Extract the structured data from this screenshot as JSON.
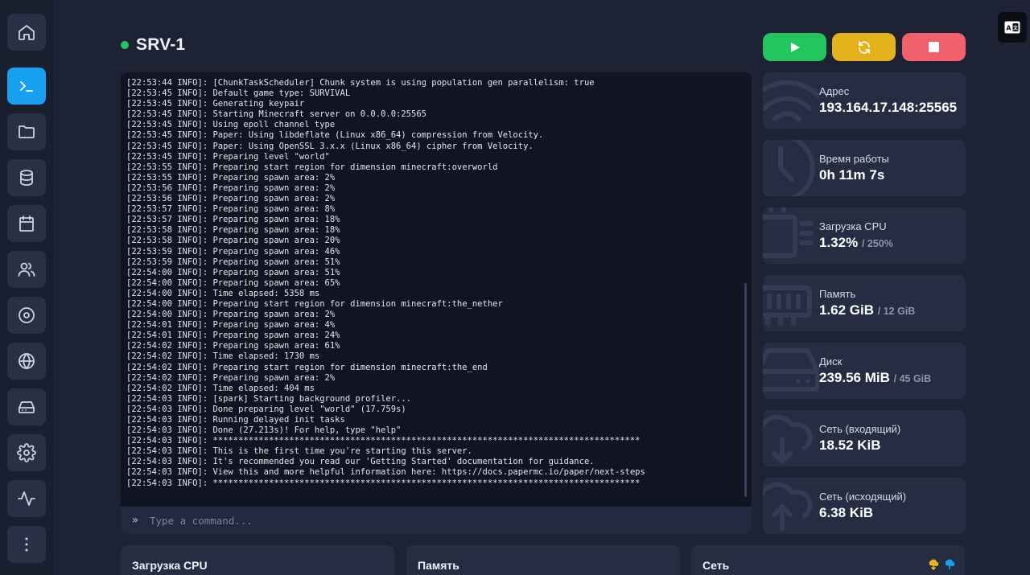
{
  "sidebar": {
    "items": [
      {
        "name": "home-icon",
        "active": false
      },
      {
        "name": "console-icon",
        "active": true
      },
      {
        "name": "folder-icon",
        "active": false
      },
      {
        "name": "database-icon",
        "active": false
      },
      {
        "name": "calendar-icon",
        "active": false
      },
      {
        "name": "users-icon",
        "active": false
      },
      {
        "name": "disc-icon",
        "active": false
      },
      {
        "name": "globe-icon",
        "active": false
      },
      {
        "name": "drive-icon",
        "active": false
      },
      {
        "name": "gear-icon",
        "active": false
      },
      {
        "name": "activity-icon",
        "active": false
      },
      {
        "name": "more-vertical-icon",
        "active": false
      }
    ]
  },
  "header": {
    "server_name": "SRV-1",
    "status_color": "#22c55e"
  },
  "controls": {
    "start_color": "#22c55e",
    "restart_color": "#e4b21c",
    "stop_color": "#f1616b"
  },
  "console": {
    "lines": [
      "[22:53:44 INFO]: [ChunkTaskScheduler] Chunk system is using population gen parallelism: true",
      "[22:53:45 INFO]: Default game type: SURVIVAL",
      "[22:53:45 INFO]: Generating keypair",
      "[22:53:45 INFO]: Starting Minecraft server on 0.0.0.0:25565",
      "[22:53:45 INFO]: Using epoll channel type",
      "[22:53:45 INFO]: Paper: Using libdeflate (Linux x86_64) compression from Velocity.",
      "[22:53:45 INFO]: Paper: Using OpenSSL 3.x.x (Linux x86_64) cipher from Velocity.",
      "[22:53:45 INFO]: Preparing level \"world\"",
      "[22:53:55 INFO]: Preparing start region for dimension minecraft:overworld",
      "[22:53:55 INFO]: Preparing spawn area: 2%",
      "[22:53:56 INFO]: Preparing spawn area: 2%",
      "[22:53:56 INFO]: Preparing spawn area: 2%",
      "[22:53:57 INFO]: Preparing spawn area: 8%",
      "[22:53:57 INFO]: Preparing spawn area: 18%",
      "[22:53:58 INFO]: Preparing spawn area: 18%",
      "[22:53:58 INFO]: Preparing spawn area: 20%",
      "[22:53:59 INFO]: Preparing spawn area: 46%",
      "[22:53:59 INFO]: Preparing spawn area: 51%",
      "[22:54:00 INFO]: Preparing spawn area: 51%",
      "[22:54:00 INFO]: Preparing spawn area: 65%",
      "[22:54:00 INFO]: Time elapsed: 5358 ms",
      "[22:54:00 INFO]: Preparing start region for dimension minecraft:the_nether",
      "[22:54:00 INFO]: Preparing spawn area: 2%",
      "[22:54:01 INFO]: Preparing spawn area: 4%",
      "[22:54:01 INFO]: Preparing spawn area: 24%",
      "[22:54:02 INFO]: Preparing spawn area: 61%",
      "[22:54:02 INFO]: Time elapsed: 1730 ms",
      "[22:54:02 INFO]: Preparing start region for dimension minecraft:the_end",
      "[22:54:02 INFO]: Preparing spawn area: 2%",
      "[22:54:02 INFO]: Time elapsed: 404 ms",
      "[22:54:03 INFO]: [spark] Starting background profiler...",
      "[22:54:03 INFO]: Done preparing level \"world\" (17.759s)",
      "[22:54:03 INFO]: Running delayed init tasks",
      "[22:54:03 INFO]: Done (27.213s)! For help, type \"help\"",
      "[22:54:03 INFO]: ************************************************************************************",
      "[22:54:03 INFO]: This is the first time you're starting this server.",
      "[22:54:03 INFO]: It's recommended you read our 'Getting Started' documentation for guidance.",
      "[22:54:03 INFO]: View this and more helpful information here: https://docs.papermc.io/paper/next-steps",
      "[22:54:03 INFO]: ************************************************************************************"
    ],
    "prompt_symbol": "»",
    "input_placeholder": "Type a command..."
  },
  "stats": [
    {
      "icon": "wifi-icon",
      "label": "Адрес",
      "value": "193.164.17.148:25565",
      "of": ""
    },
    {
      "icon": "clock-icon",
      "label": "Время работы",
      "value": "0h 11m 7s",
      "of": ""
    },
    {
      "icon": "cpu-icon",
      "label": "Загрузка CPU",
      "value": "1.32%",
      "of": "/ 250%"
    },
    {
      "icon": "memory-icon",
      "label": "Память",
      "value": "1.62 GiB",
      "of": "/ 12 GiB"
    },
    {
      "icon": "hard-drive-icon",
      "label": "Диск",
      "value": "239.56 MiB",
      "of": "/ 45 GiB"
    },
    {
      "icon": "download-cloud-icon",
      "label": "Сеть (входящий)",
      "value": "18.52 KiB",
      "of": ""
    },
    {
      "icon": "upload-cloud-icon",
      "label": "Сеть (исходящий)",
      "value": "6.38 KiB",
      "of": ""
    }
  ],
  "graphs": [
    {
      "title": "Загрузка CPU"
    },
    {
      "title": "Память"
    },
    {
      "title": "Сеть",
      "legend_colors": [
        "#e4b21c",
        "#18a0f0"
      ]
    }
  ]
}
